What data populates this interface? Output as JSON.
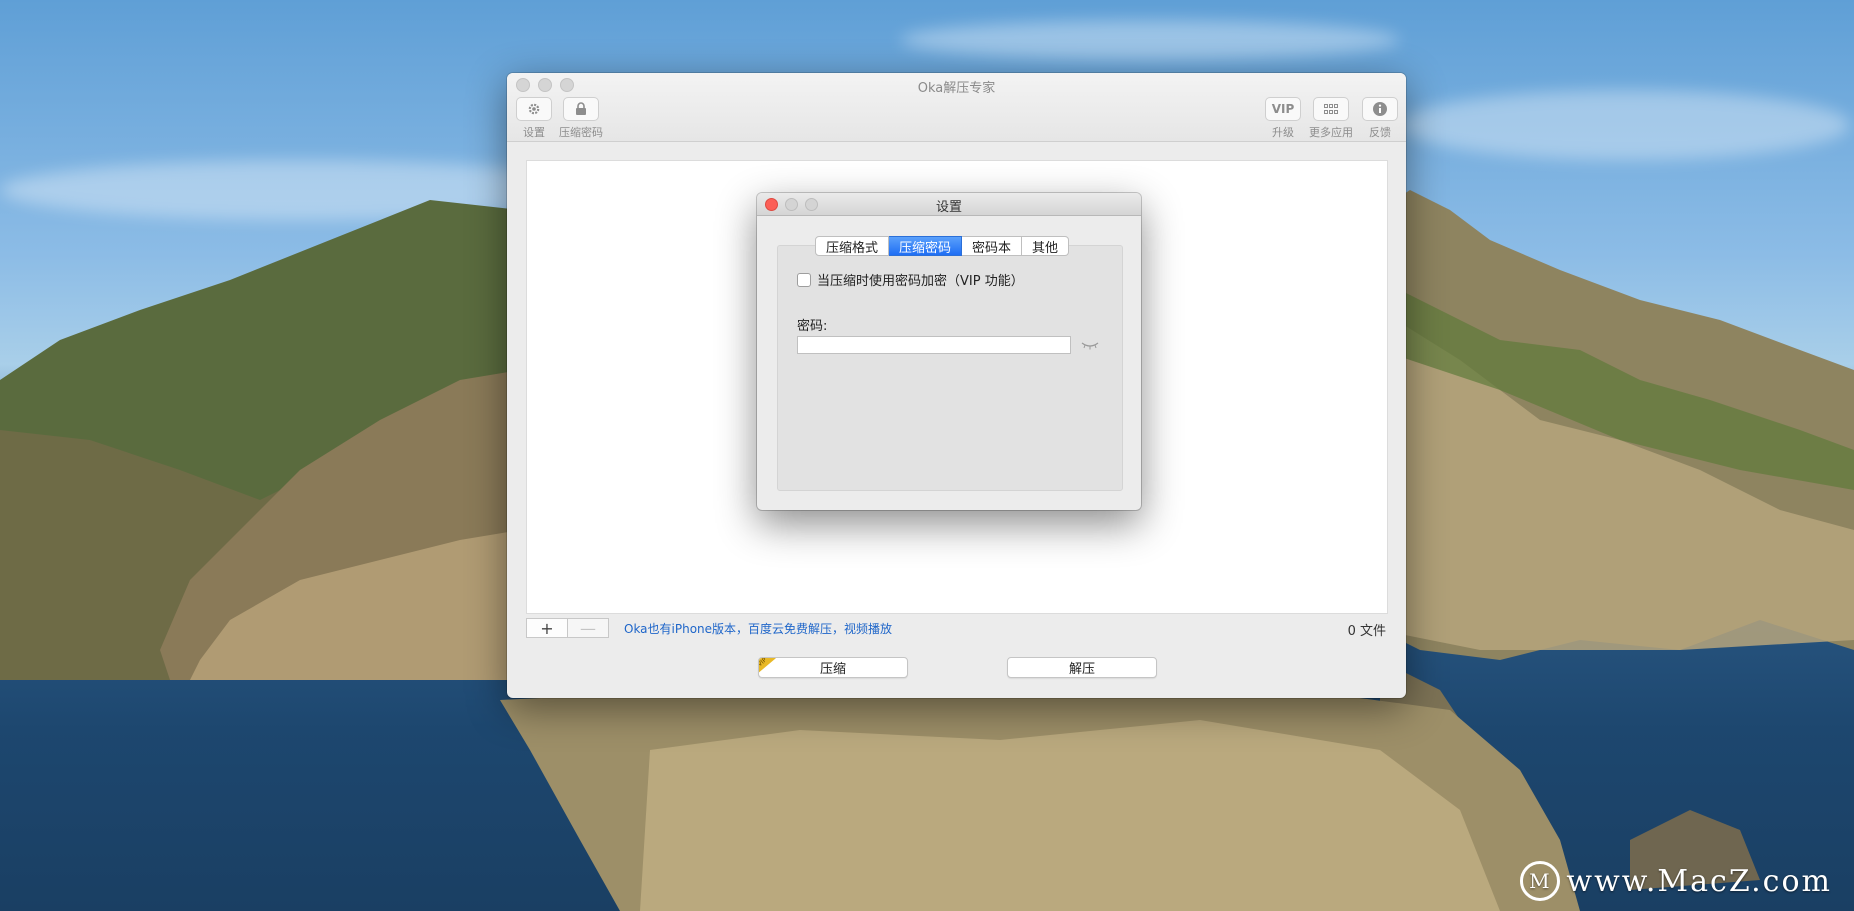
{
  "app": {
    "window_title": "Oka解压专家",
    "toolbar_left": [
      {
        "icon": "gear-icon",
        "label": "设置"
      },
      {
        "icon": "lock-icon",
        "label": "压缩密码"
      }
    ],
    "toolbar_right": [
      {
        "icon": "vip-badge",
        "icon_text": "VIP",
        "label": "升级"
      },
      {
        "icon": "grid-icon",
        "label": "更多应用"
      },
      {
        "icon": "info-icon",
        "label": "反馈"
      }
    ],
    "add_glyph": "+",
    "remove_glyph": "—",
    "promo_text": "Oka也有iPhone版本，百度云免费解压，视频播放",
    "file_count": "0 文件",
    "compress_label": "压缩",
    "compress_badge": "VIP",
    "extract_label": "解压"
  },
  "dialog": {
    "title": "设置",
    "tabs": [
      "压缩格式",
      "压缩密码",
      "密码本",
      "其他"
    ],
    "active_tab": 1,
    "encrypt_checkbox_label": "当压缩时使用密码加密（VIP 功能）",
    "encrypt_checked": false,
    "password_label": "密码:",
    "password_value": ""
  },
  "desktop": {
    "watermark": "www.MacZ.com",
    "watermark_logo": "M"
  },
  "colors": {
    "accent": "#1f6ef4",
    "link": "#1f66c9",
    "close_red": "#fc5f57"
  }
}
